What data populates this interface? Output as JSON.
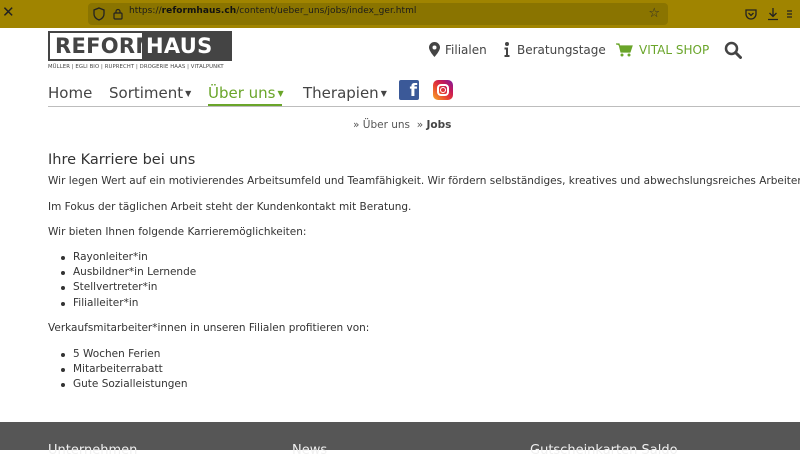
{
  "browser": {
    "url_prefix": "https://",
    "url_host": "reformhaus.ch",
    "url_path": "/content/ueber_uns/jobs/index_ger.html"
  },
  "logo": {
    "part1": "REFORM",
    "part2": "HAUS",
    "subtitle": "MÜLLER | EGLI BIO | RUPRECHT | DROGERIE HAAS | VITALPUNKT"
  },
  "toplinks": {
    "filialen": "Filialen",
    "beratungstage": "Beratungstage",
    "vital_shop": "VITAL SHOP"
  },
  "nav": {
    "home": "Home",
    "sortiment": "Sortiment",
    "ueber_uns": "Über uns",
    "therapien": "Therapien"
  },
  "breadcrumb": {
    "sep": "»",
    "item1": "Über uns",
    "item2": "Jobs"
  },
  "content": {
    "title": "Ihre Karriere bei uns",
    "p1": "Wir legen Wert auf ein motivierendes Arbeitsumfeld und Teamfähigkeit. Wir fördern selbständiges, kreatives und abwechslungsreiches Arbeiten.",
    "p2": "Im Fokus der täglichen Arbeit steht der Kundenkontakt mit Beratung.",
    "p3": "Wir bieten Ihnen folgende Karrieremöglichkeiten:",
    "careers": [
      "Rayonleiter*in",
      "Ausbildner*in Lernende",
      "Stellvertreter*in",
      "Filialleiter*in"
    ],
    "p4": "Verkaufsmitarbeiter*innen in unseren Filialen profitieren von:",
    "benefits": [
      "5 Wochen Ferien",
      "Mitarbeiterrabatt",
      "Gute Sozialleistungen"
    ]
  },
  "footer": {
    "col1": "Unternehmen",
    "col2": "News",
    "col3": "Gutscheinkarten Saldo"
  },
  "colors": {
    "accent_green": "#6aa52a",
    "browser_bar": "#a08400",
    "footer_bg": "#565656",
    "text": "#333333"
  }
}
